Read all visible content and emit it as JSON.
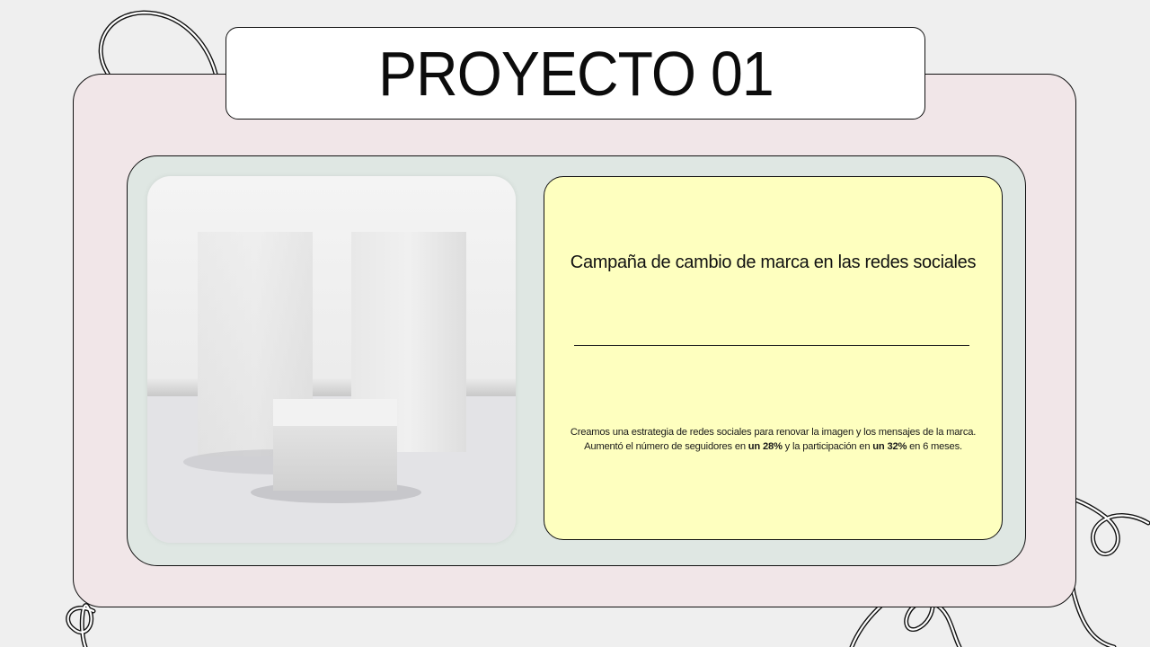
{
  "slide": {
    "title": "PROYECTO 01",
    "card": {
      "heading": "Campaña de cambio de marca en las redes sociales",
      "body": {
        "line1": "Creamos una estrategia de redes sociales para renovar la imagen y los mensajes de la marca.",
        "line2_prefix": "Aumentó el número de seguidores en ",
        "stat1": "un 28%",
        "line2_middle": " y la participación en ",
        "stat2": "un 32%",
        "line2_suffix": " en 6 meses."
      }
    }
  },
  "colors": {
    "background": "#efefef",
    "outer_panel": "#f1e6e8",
    "inner_panel": "#dfe7e3",
    "card": "#feffbf",
    "title_bar": "#ffffff",
    "outline": "#111111"
  },
  "decorations": [
    "looped-string-doodle"
  ],
  "image": {
    "subject": "white-pedestals-product-display-photo"
  }
}
